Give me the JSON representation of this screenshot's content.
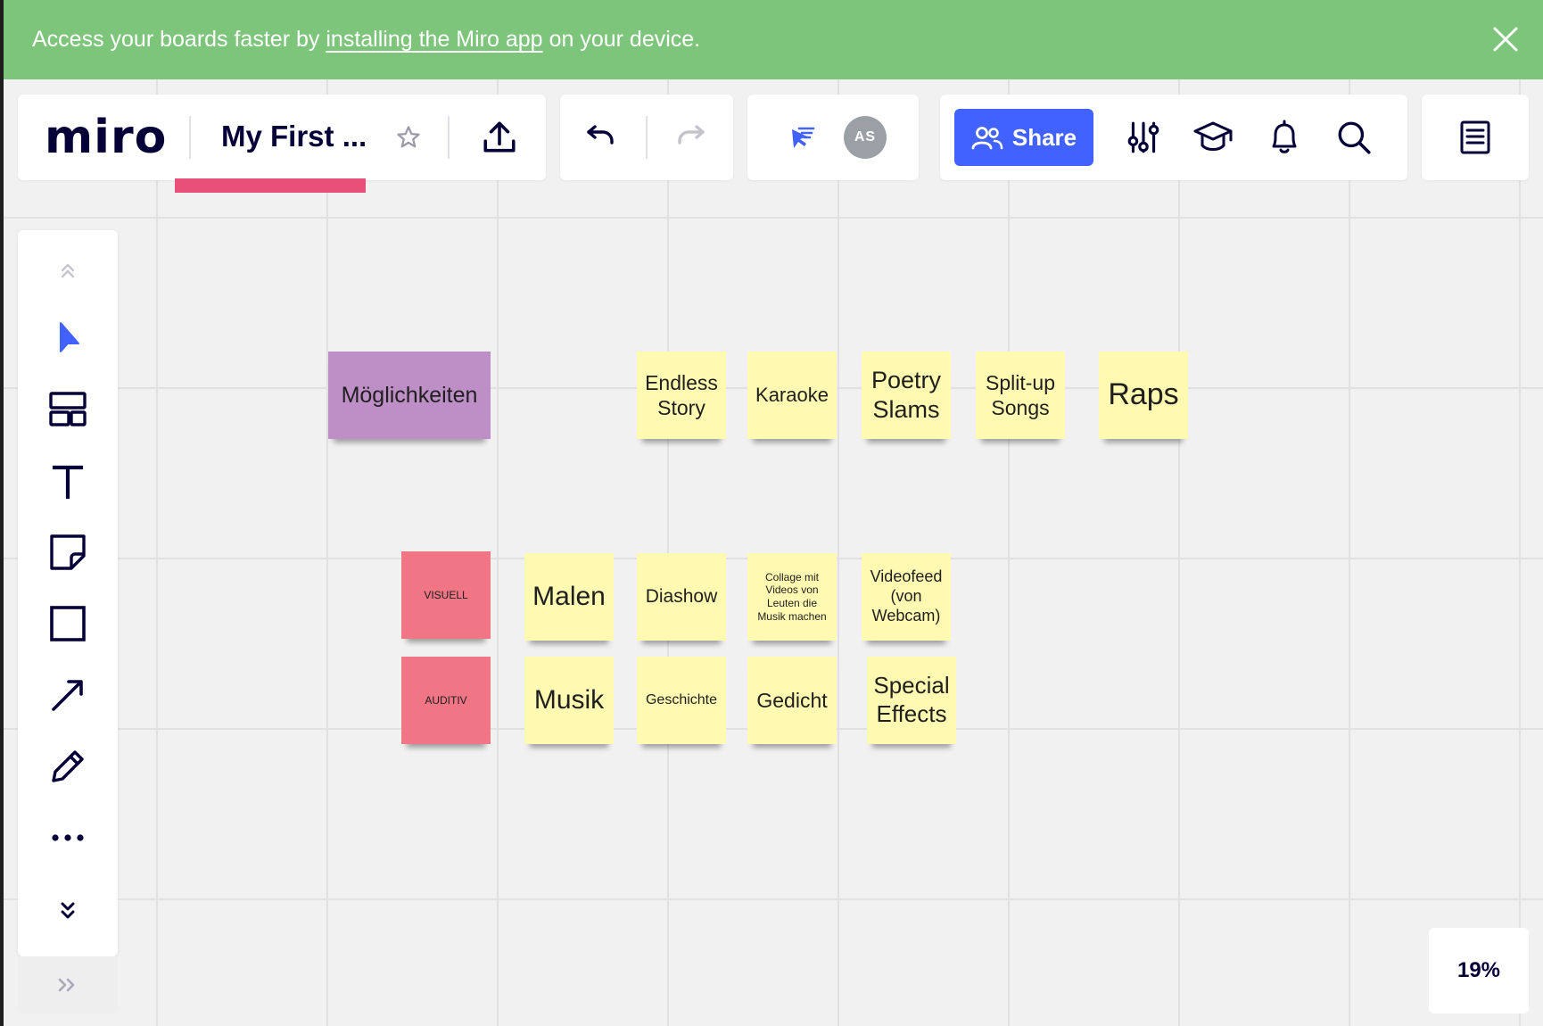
{
  "banner": {
    "text_before": "Access your boards faster by",
    "link_text": "installing the Miro app",
    "text_after": "on your device."
  },
  "header": {
    "logo": "miro",
    "board_title": "My First ...",
    "share_label": "Share",
    "avatar_initials": "AS"
  },
  "colors": {
    "banner": "#7ec57c",
    "accent": "#4262ff",
    "sticky_yellow": "#fff9b1",
    "sticky_purple": "#be8fc6",
    "sticky_pink": "#f07585"
  },
  "toolbar_icons": [
    "chevron-up-icon",
    "select-cursor-icon",
    "templates-icon",
    "text-tool-icon",
    "sticky-note-icon",
    "shape-icon",
    "arrow-line-icon",
    "pen-icon",
    "more-tools-icon",
    "chevron-down-icon"
  ],
  "board": {
    "stickies": [
      {
        "text": "Möglichkeiten",
        "color": "purple"
      },
      {
        "text": "Endless Story",
        "color": "yellow"
      },
      {
        "text": "Karaoke",
        "color": "yellow"
      },
      {
        "text": "Poetry Slams",
        "color": "yellow"
      },
      {
        "text": "Split-up Songs",
        "color": "yellow"
      },
      {
        "text": "Raps",
        "color": "yellow"
      },
      {
        "text": "VISUELL",
        "color": "pink"
      },
      {
        "text": "Malen",
        "color": "yellow"
      },
      {
        "text": "Diashow",
        "color": "yellow"
      },
      {
        "text": "Collage mit Videos von Leuten die Musik machen",
        "color": "yellow"
      },
      {
        "text": "Videofeed (von Webcam)",
        "color": "yellow"
      },
      {
        "text": "AUDITIV",
        "color": "pink"
      },
      {
        "text": "Musik",
        "color": "yellow"
      },
      {
        "text": "Geschichte",
        "color": "yellow"
      },
      {
        "text": "Gedicht",
        "color": "yellow"
      },
      {
        "text": "Special Effects",
        "color": "yellow"
      }
    ]
  },
  "zoom": "19%"
}
